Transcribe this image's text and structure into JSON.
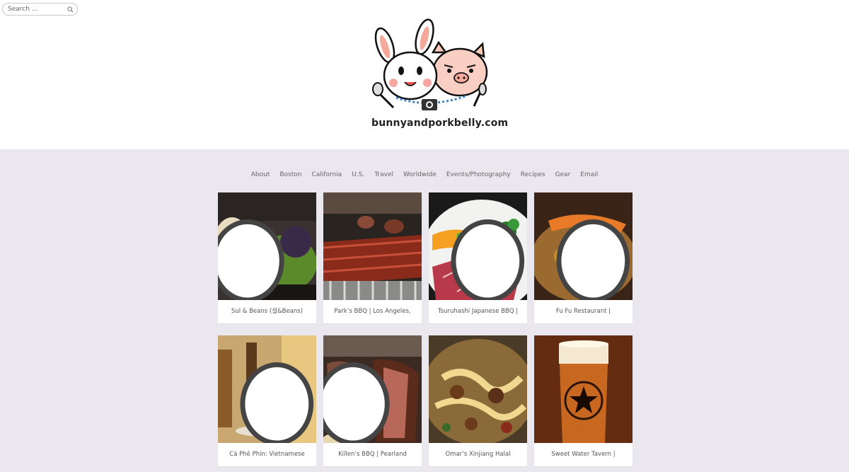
{
  "search": {
    "placeholder": "Search ..."
  },
  "site": {
    "logo_text": "bunnyandporkbelly.com"
  },
  "nav": [
    "About",
    "Boston",
    "California",
    "U.S.",
    "Travel",
    "Worldwide",
    "Events/Photography",
    "Recipes",
    "Gear",
    "Email"
  ],
  "posts": [
    {
      "title": "Sul & Beans (설&Beans)"
    },
    {
      "title": "Park’s BBQ | Los Angeles,"
    },
    {
      "title": "Tsuruhashi Japanese BBQ |"
    },
    {
      "title": "Fu Fu Restaurant |"
    },
    {
      "title": "Cà Phê Phin: Vietnamese"
    },
    {
      "title": "Killen’s BBQ | Pearland"
    },
    {
      "title": "Omar’s Xinjiang Halal"
    },
    {
      "title": "Sweet Water Tavern |"
    }
  ],
  "colors": {
    "page_bg": "#ebe7ee",
    "header_bg": "#ffffff",
    "text": "#666666"
  }
}
